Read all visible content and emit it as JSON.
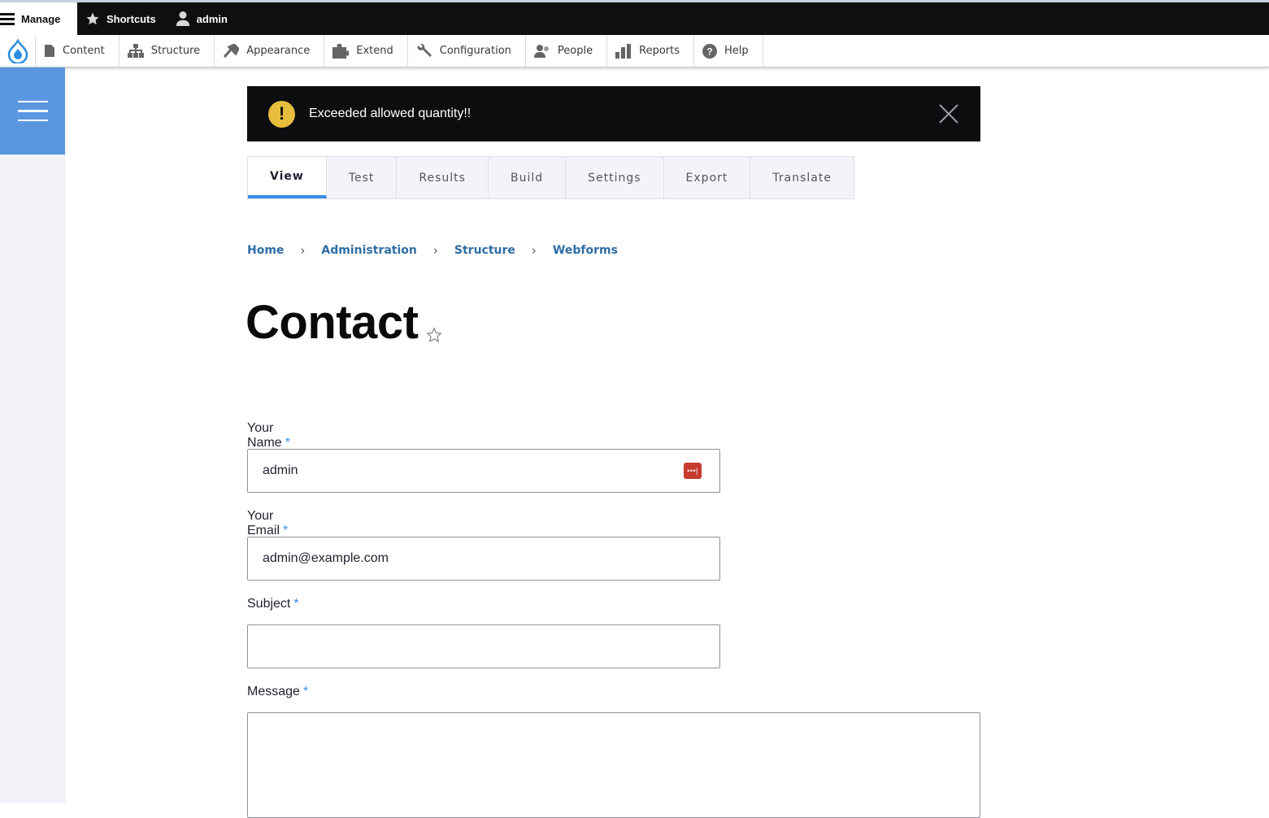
{
  "toolbar": {
    "manage_label": "Manage",
    "shortcuts_label": "Shortcuts",
    "user_label": "admin"
  },
  "tray": {
    "items": [
      {
        "label": "Content",
        "icon": "file-icon"
      },
      {
        "label": "Structure",
        "icon": "sitemap-icon"
      },
      {
        "label": "Appearance",
        "icon": "paint-brush-icon"
      },
      {
        "label": "Extend",
        "icon": "puzzle-icon"
      },
      {
        "label": "Configuration",
        "icon": "wrench-icon"
      },
      {
        "label": "People",
        "icon": "people-icon"
      },
      {
        "label": "Reports",
        "icon": "bar-chart-icon"
      },
      {
        "label": "Help",
        "icon": "help-icon"
      }
    ]
  },
  "alert": {
    "message": "Exceeded allowed quantity!!",
    "icon": "warning-icon",
    "color": "#e7bd3d"
  },
  "tabs": [
    "View",
    "Test",
    "Results",
    "Build",
    "Settings",
    "Export",
    "Translate"
  ],
  "active_tab": "View",
  "breadcrumb": [
    "Home",
    "Administration",
    "Structure",
    "Webforms"
  ],
  "page_title": "Contact",
  "form": {
    "name_label": "Your Name",
    "name_value": "admin",
    "email_label": "Your Email",
    "email_value": "admin@example.com",
    "subject_label": "Subject",
    "subject_value": "",
    "message_label": "Message",
    "required_marker": "*"
  },
  "colors": {
    "accent": "#3a8ee8",
    "link": "#2e6da4",
    "sidebar": "#5a97e0"
  }
}
